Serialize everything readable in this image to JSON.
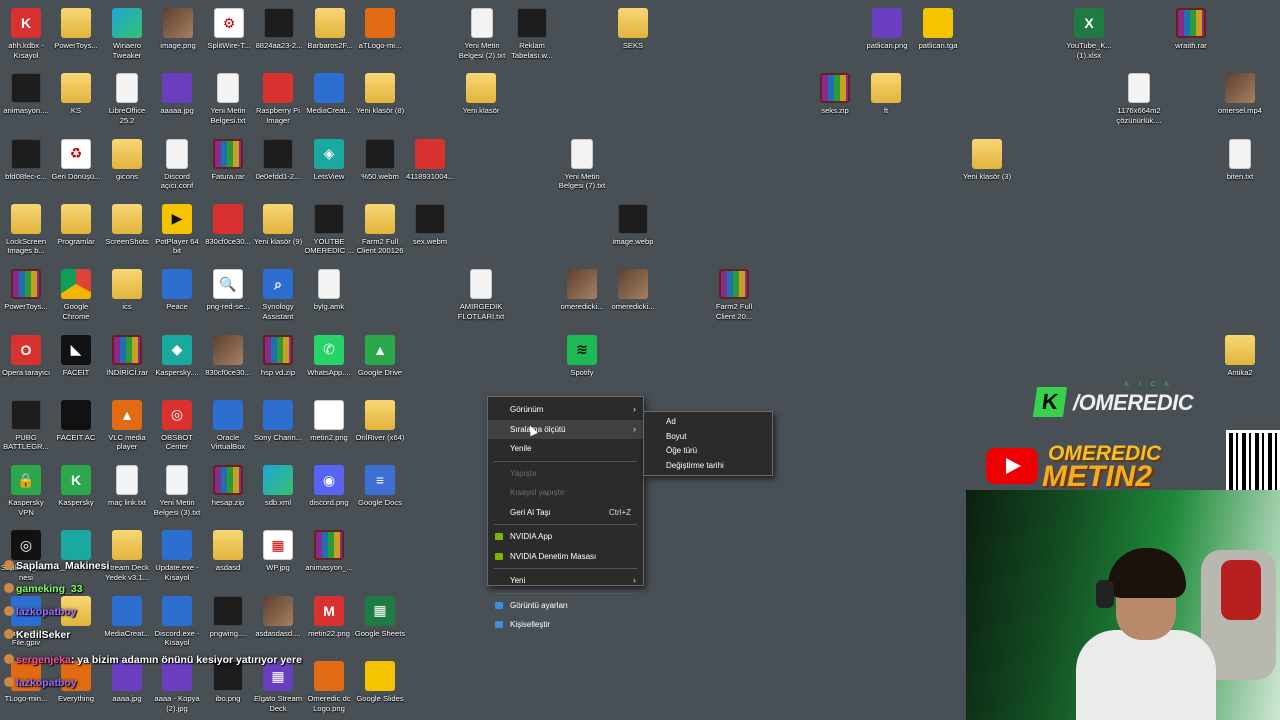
{
  "desktop": {
    "icons": [
      {
        "label": "ahh.kdbx - Kısayol",
        "type": "red",
        "glyph": "K"
      },
      {
        "label": "PowerToys...",
        "type": "folder",
        "glyph": ""
      },
      {
        "label": "Winaero Tweaker",
        "type": "edge",
        "glyph": ""
      },
      {
        "label": "image.png",
        "type": "img",
        "glyph": ""
      },
      {
        "label": "SplitWire-T...",
        "type": "white",
        "glyph": "⚙"
      },
      {
        "label": "8824aa23-2...",
        "type": "dark",
        "glyph": ""
      },
      {
        "label": "Barbaros2F...",
        "type": "folder",
        "glyph": ""
      },
      {
        "label": "aTLogo-mi...",
        "type": "orange",
        "glyph": ""
      },
      {
        "label": "Yeni Metin Belgesi (2).txt",
        "type": "doc",
        "glyph": ""
      },
      {
        "label": "Reklam Tabelası.w...",
        "type": "dark",
        "glyph": ""
      },
      {
        "label": "SEKS",
        "type": "folder",
        "glyph": ""
      },
      {
        "label": "patlican.png",
        "type": "purple",
        "glyph": ""
      },
      {
        "label": "patlican.tga",
        "type": "yellow",
        "glyph": ""
      },
      {
        "label": "YouTube_K... (1).xlsx",
        "type": "excel",
        "glyph": "X"
      },
      {
        "label": "wraith.rar",
        "type": "rar",
        "glyph": ""
      },
      {
        "label": "animasyon....",
        "type": "dark",
        "glyph": ""
      },
      {
        "label": "KS",
        "type": "folder",
        "glyph": ""
      },
      {
        "label": "LibreOffice 25.2",
        "type": "doc",
        "glyph": ""
      },
      {
        "label": "aaaaa.jpg",
        "type": "purple",
        "glyph": ""
      },
      {
        "label": "Yeni Metin Belgesi.txt",
        "type": "doc",
        "glyph": ""
      },
      {
        "label": "Raspberry Pi Imager",
        "type": "red",
        "glyph": ""
      },
      {
        "label": "MediaCreat...",
        "type": "app",
        "glyph": ""
      },
      {
        "label": "Yeni klasör (8)",
        "type": "folder",
        "glyph": ""
      },
      {
        "label": "Yeni klasör",
        "type": "folder",
        "glyph": ""
      },
      {
        "label": "seks.zip",
        "type": "rar",
        "glyph": ""
      },
      {
        "label": "ft",
        "type": "folder",
        "glyph": ""
      },
      {
        "label": "1176x664m2 çözünürlük....",
        "type": "doc",
        "glyph": ""
      },
      {
        "label": "omersel.mp4",
        "type": "img",
        "glyph": ""
      },
      {
        "label": "bfd08fec-c...",
        "type": "dark",
        "glyph": ""
      },
      {
        "label": "Geri Dönüşü...",
        "type": "white",
        "glyph": "♻"
      },
      {
        "label": "gicons",
        "type": "folder",
        "glyph": ""
      },
      {
        "label": "Discord açıcı.conf",
        "type": "doc",
        "glyph": ""
      },
      {
        "label": "Fatura.rar",
        "type": "rar",
        "glyph": ""
      },
      {
        "label": "0e0efdd1-2...",
        "type": "dark",
        "glyph": ""
      },
      {
        "label": "LetsView",
        "type": "cyan",
        "glyph": "◈"
      },
      {
        "label": "%50.webm",
        "type": "dark",
        "glyph": ""
      },
      {
        "label": "4118931004...",
        "type": "red",
        "glyph": ""
      },
      {
        "label": "Yeni Metin Belgesi (7).txt",
        "type": "doc",
        "glyph": ""
      },
      {
        "label": "Yeni klasör (3)",
        "type": "folder",
        "glyph": ""
      },
      {
        "label": "biten.txt",
        "type": "doc",
        "glyph": ""
      },
      {
        "label": "LockScreen Images b...",
        "type": "folder",
        "glyph": ""
      },
      {
        "label": "Programlar",
        "type": "folder",
        "glyph": ""
      },
      {
        "label": "ScreenShots",
        "type": "folder",
        "glyph": ""
      },
      {
        "label": "PotPlayer 64 bit",
        "type": "yellow",
        "glyph": "▶"
      },
      {
        "label": "830cf0ce30...",
        "type": "red",
        "glyph": ""
      },
      {
        "label": "Yeni klasör (9)",
        "type": "folder",
        "glyph": ""
      },
      {
        "label": "YOUTBE OMEREDIC ...",
        "type": "dark",
        "glyph": ""
      },
      {
        "label": "Farm2 Full Client 200126",
        "type": "folder",
        "glyph": ""
      },
      {
        "label": "sex.webm",
        "type": "dark",
        "glyph": ""
      },
      {
        "label": "image.webp",
        "type": "dark",
        "glyph": ""
      },
      {
        "label": "PowerToys...",
        "type": "rar",
        "glyph": ""
      },
      {
        "label": "Google Chrome",
        "type": "chrome",
        "glyph": ""
      },
      {
        "label": "ics",
        "type": "folder",
        "glyph": ""
      },
      {
        "label": "Peace",
        "type": "app",
        "glyph": ""
      },
      {
        "label": "png-red-se...",
        "type": "white",
        "glyph": "🔍"
      },
      {
        "label": "Synology Assistant",
        "type": "app",
        "glyph": "⌕"
      },
      {
        "label": "bylg.amk",
        "type": "doc",
        "glyph": ""
      },
      {
        "label": "AMIRGEDIK FLOTLARI.txt",
        "type": "doc",
        "glyph": ""
      },
      {
        "label": "omeredicki...",
        "type": "img",
        "glyph": ""
      },
      {
        "label": "omeredicki...",
        "type": "img",
        "glyph": ""
      },
      {
        "label": "Farm2 Full Client 20...",
        "type": "rar",
        "glyph": ""
      },
      {
        "label": "Opera tarayıcı",
        "type": "red",
        "glyph": "O"
      },
      {
        "label": "FACEIT",
        "type": "black",
        "glyph": "◣"
      },
      {
        "label": "İNDİRİCİ.rar",
        "type": "rar",
        "glyph": ""
      },
      {
        "label": "Kaspersky....",
        "type": "cyan",
        "glyph": "◆"
      },
      {
        "label": "830cf0ce30...",
        "type": "img",
        "glyph": ""
      },
      {
        "label": "hsp vd.zip",
        "type": "rar",
        "glyph": ""
      },
      {
        "label": "WhatsApp....",
        "type": "whatsapp",
        "glyph": "✆"
      },
      {
        "label": "Google Drive",
        "type": "green",
        "glyph": "▲"
      },
      {
        "label": "Spotify",
        "type": "spotify",
        "glyph": "≋"
      },
      {
        "label": "Antika2",
        "type": "folder",
        "glyph": ""
      },
      {
        "label": "PUBG BATTLEGR...",
        "type": "dark",
        "glyph": ""
      },
      {
        "label": "FACEIT AC",
        "type": "black",
        "glyph": ""
      },
      {
        "label": "VLC media player",
        "type": "orange",
        "glyph": "▲"
      },
      {
        "label": "OBSBOT Center",
        "type": "red",
        "glyph": "◎"
      },
      {
        "label": "Oracle VirtualBox",
        "type": "app",
        "glyph": ""
      },
      {
        "label": "Sony Chann...",
        "type": "app",
        "glyph": ""
      },
      {
        "label": "metin2.png",
        "type": "white",
        "glyph": ""
      },
      {
        "label": "OrilRiver (x64)",
        "type": "folder",
        "glyph": ""
      },
      {
        "label": "Kaspersky VPN",
        "type": "green",
        "glyph": "🔒"
      },
      {
        "label": "Kaspersky",
        "type": "green",
        "glyph": "K"
      },
      {
        "label": "maç link.txt",
        "type": "doc",
        "glyph": ""
      },
      {
        "label": "Yeni Metin Belgesi (3).txt",
        "type": "doc",
        "glyph": ""
      },
      {
        "label": "hesap.zip",
        "type": "rar",
        "glyph": ""
      },
      {
        "label": "sdb.xml",
        "type": "edge",
        "glyph": ""
      },
      {
        "label": "discord.png",
        "type": "discord",
        "glyph": "◉"
      },
      {
        "label": "Google Docs",
        "type": "word",
        "glyph": "≡"
      },
      {
        "label": "Saplama_Makinesi",
        "type": "black",
        "glyph": "◎"
      },
      {
        "label": "",
        "type": "cyan",
        "glyph": ""
      },
      {
        "label": "Stream Deck Yedek v3.1...",
        "type": "folder",
        "glyph": ""
      },
      {
        "label": "Update.exe - Kısayol",
        "type": "app",
        "glyph": ""
      },
      {
        "label": "asdasd",
        "type": "folder",
        "glyph": ""
      },
      {
        "label": "WP.jpg",
        "type": "white",
        "glyph": "▦"
      },
      {
        "label": "animasyon_...",
        "type": "rar",
        "glyph": ""
      },
      {
        "label": "Saves Dark File.gpiv",
        "type": "app",
        "glyph": ""
      },
      {
        "label": "",
        "type": "folder",
        "glyph": ""
      },
      {
        "label": "MediaCreat...",
        "type": "app",
        "glyph": ""
      },
      {
        "label": "Discord.exe - Kısayol",
        "type": "app",
        "glyph": ""
      },
      {
        "label": "pngwing....",
        "type": "dark",
        "glyph": ""
      },
      {
        "label": "asdasdasd....",
        "type": "img",
        "glyph": ""
      },
      {
        "label": "metin22.png",
        "type": "red",
        "glyph": "M"
      },
      {
        "label": "Google Sheets",
        "type": "excel",
        "glyph": "▦"
      },
      {
        "label": "TLogo-min...",
        "type": "orange",
        "glyph": ""
      },
      {
        "label": "Everything",
        "type": "orange",
        "glyph": ""
      },
      {
        "label": "aaaa.jpg",
        "type": "purple",
        "glyph": ""
      },
      {
        "label": "aaaa - Kopya (2).jpg",
        "type": "purple",
        "glyph": ""
      },
      {
        "label": "ibo.png",
        "type": "dark",
        "glyph": ""
      },
      {
        "label": "Elgato Stream Deck",
        "type": "purple",
        "glyph": "▦"
      },
      {
        "label": "Omeredic dc Logo.png",
        "type": "orange",
        "glyph": ""
      },
      {
        "label": "Google Slides",
        "type": "yellow",
        "glyph": ""
      }
    ]
  },
  "context_menu": {
    "items": [
      {
        "label": "Görünüm",
        "arrow": "›",
        "shortcut": "",
        "disabled": false,
        "highlight": false,
        "icon": ""
      },
      {
        "label": "Sıralama ölçütü",
        "arrow": "›",
        "shortcut": "",
        "disabled": false,
        "highlight": true,
        "icon": ""
      },
      {
        "label": "Yenile",
        "arrow": "",
        "shortcut": "",
        "disabled": false,
        "highlight": false,
        "icon": ""
      },
      {
        "sep": true
      },
      {
        "label": "Yapıştır",
        "arrow": "",
        "shortcut": "",
        "disabled": true,
        "highlight": false,
        "icon": ""
      },
      {
        "label": "Kısayol yapıştır",
        "arrow": "",
        "shortcut": "",
        "disabled": true,
        "highlight": false,
        "icon": ""
      },
      {
        "label": "Geri Al Taşı",
        "arrow": "",
        "shortcut": "Ctrl+Z",
        "disabled": false,
        "highlight": false,
        "icon": ""
      },
      {
        "sep": true
      },
      {
        "label": "NVIDIA App",
        "arrow": "",
        "shortcut": "",
        "disabled": false,
        "highlight": false,
        "icon": "nvidia-icon"
      },
      {
        "label": "NVIDIA Denetim Masası",
        "arrow": "",
        "shortcut": "",
        "disabled": false,
        "highlight": false,
        "icon": "nvidia-icon"
      },
      {
        "sep": true
      },
      {
        "label": "Yeni",
        "arrow": "›",
        "shortcut": "",
        "disabled": false,
        "highlight": false,
        "icon": ""
      },
      {
        "sep": true
      },
      {
        "label": "Görüntü ayarları",
        "arrow": "",
        "shortcut": "",
        "disabled": false,
        "highlight": false,
        "icon": "display-icon"
      },
      {
        "label": "Kişiselleştir",
        "arrow": "",
        "shortcut": "",
        "disabled": false,
        "highlight": false,
        "icon": "personalize-icon"
      }
    ]
  },
  "sort_submenu": {
    "items": [
      "Ad",
      "Boyut",
      "Öğe türü",
      "Değiştirme tarihi"
    ]
  },
  "overlay": {
    "kick_label": "KICK",
    "brand_k": "K",
    "brand_name": "/OMEREDIC",
    "banner_line1": "OMEREDIC",
    "banner_line2": "METIN2"
  },
  "chat": [
    {
      "user": "Saplama_Makinesi",
      "message": "",
      "color": "#ffffff"
    },
    {
      "user": "gameking_33",
      "message": "",
      "color": "#7dff5a"
    },
    {
      "user": "lazkopatboy",
      "message": "",
      "color": "#9b6bff"
    },
    {
      "user": "KedilSeker",
      "message": "",
      "color": "#ffffff"
    },
    {
      "user": "sergenjeka",
      "message": ": ya bizim adamın önünü kesiyor yatırıyor yere",
      "color": "#ff4fa3"
    },
    {
      "user": "lazkopatboy",
      "message": "",
      "color": "#9b6bff"
    }
  ]
}
